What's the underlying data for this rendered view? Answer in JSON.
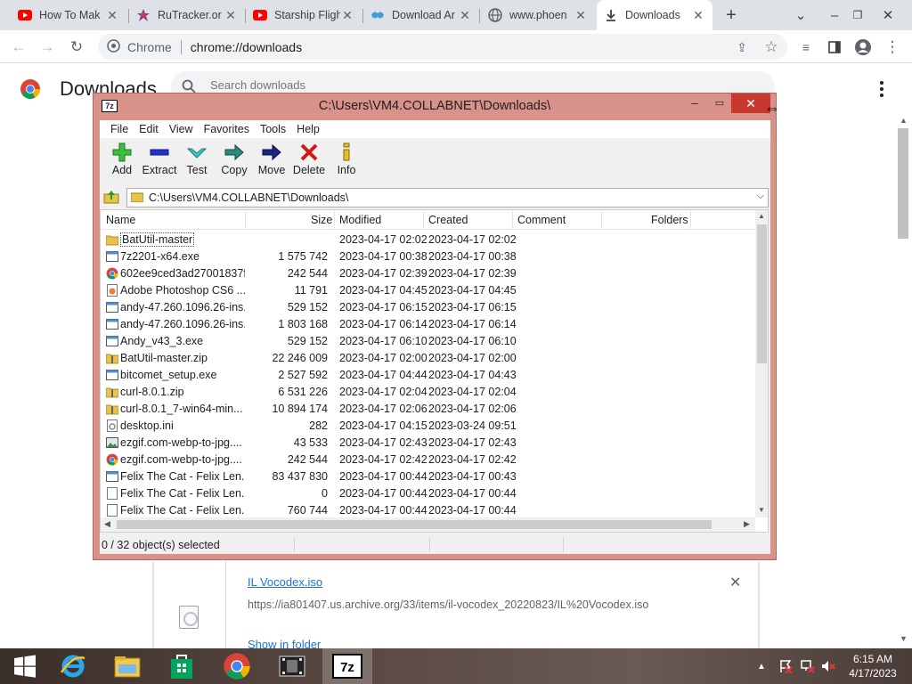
{
  "browser": {
    "tabs": [
      {
        "title": "How To Mak",
        "icon": "youtube-icon"
      },
      {
        "title": "RuTracker.or",
        "icon": "rutracker-icon"
      },
      {
        "title": "Starship Fligh",
        "icon": "youtube-icon"
      },
      {
        "title": "Download Ar",
        "icon": "archive-icon"
      },
      {
        "title": "www.phoen",
        "icon": "globe-icon"
      },
      {
        "title": "Downloads",
        "icon": "download-icon"
      }
    ],
    "omnibox": {
      "site": "Chrome",
      "url": "chrome://downloads"
    }
  },
  "downloads_page": {
    "title": "Downloads",
    "search_placeholder": "Search downloads",
    "item": {
      "filename": "IL Vocodex.iso",
      "url": "https://ia801407.us.archive.org/33/items/il-vocodex_20220823/IL%20Vocodex.iso",
      "show_in_folder": "Show in folder"
    }
  },
  "sevenzip": {
    "title": "C:\\Users\\VM4.COLLABNET\\Downloads\\",
    "app_icon_text": "7z",
    "menu": [
      "File",
      "Edit",
      "View",
      "Favorites",
      "Tools",
      "Help"
    ],
    "toolbar": [
      "Add",
      "Extract",
      "Test",
      "Copy",
      "Move",
      "Delete",
      "Info"
    ],
    "path": "C:\\Users\\VM4.COLLABNET\\Downloads\\",
    "columns": {
      "name": "Name",
      "size": "Size",
      "modified": "Modified",
      "created": "Created",
      "comment": "Comment",
      "folders": "Folders"
    },
    "files": [
      {
        "name": "BatUtil-master",
        "size": "",
        "modified": "2023-04-17 02:02",
        "created": "2023-04-17 02:02",
        "type": "folder"
      },
      {
        "name": "7z2201-x64.exe",
        "size": "1 575 742",
        "modified": "2023-04-17 00:38",
        "created": "2023-04-17 00:38",
        "type": "exe"
      },
      {
        "name": "602ee9ced3ad27001837f...",
        "size": "242 544",
        "modified": "2023-04-17 02:39",
        "created": "2023-04-17 02:39",
        "type": "chrome"
      },
      {
        "name": "Adobe Photoshop CS6 ...",
        "size": "11 791",
        "modified": "2023-04-17 04:45",
        "created": "2023-04-17 04:45",
        "type": "html"
      },
      {
        "name": "andy-47.260.1096.26-ins...",
        "size": "529 152",
        "modified": "2023-04-17 06:15",
        "created": "2023-04-17 06:15",
        "type": "exe"
      },
      {
        "name": "andy-47.260.1096.26-ins...",
        "size": "1 803 168",
        "modified": "2023-04-17 06:14",
        "created": "2023-04-17 06:14",
        "type": "exe"
      },
      {
        "name": "Andy_v43_3.exe",
        "size": "529 152",
        "modified": "2023-04-17 06:10",
        "created": "2023-04-17 06:10",
        "type": "exe"
      },
      {
        "name": "BatUtil-master.zip",
        "size": "22 246 009",
        "modified": "2023-04-17 02:00",
        "created": "2023-04-17 02:00",
        "type": "zip"
      },
      {
        "name": "bitcomet_setup.exe",
        "size": "2 527 592",
        "modified": "2023-04-17 04:44",
        "created": "2023-04-17 04:43",
        "type": "exe"
      },
      {
        "name": "curl-8.0.1.zip",
        "size": "6 531 226",
        "modified": "2023-04-17 02:04",
        "created": "2023-04-17 02:04",
        "type": "zip"
      },
      {
        "name": "curl-8.0.1_7-win64-min...",
        "size": "10 894 174",
        "modified": "2023-04-17 02:06",
        "created": "2023-04-17 02:06",
        "type": "zip"
      },
      {
        "name": "desktop.ini",
        "size": "282",
        "modified": "2023-04-17 04:15",
        "created": "2023-03-24 09:51",
        "type": "ini"
      },
      {
        "name": "ezgif.com-webp-to-jpg....",
        "size": "43 533",
        "modified": "2023-04-17 02:43",
        "created": "2023-04-17 02:43",
        "type": "image"
      },
      {
        "name": "ezgif.com-webp-to-jpg....",
        "size": "242 544",
        "modified": "2023-04-17 02:42",
        "created": "2023-04-17 02:42",
        "type": "chrome"
      },
      {
        "name": "Felix The Cat - Felix Len...",
        "size": "83 437 830",
        "modified": "2023-04-17 00:44",
        "created": "2023-04-17 00:43",
        "type": "exe"
      },
      {
        "name": "Felix The Cat - Felix Len...",
        "size": "0",
        "modified": "2023-04-17 00:44",
        "created": "2023-04-17 00:44",
        "type": "blank"
      },
      {
        "name": "Felix The Cat - Felix Len...",
        "size": "760 744",
        "modified": "2023-04-17 00:44",
        "created": "2023-04-17 00:44",
        "type": "blank"
      }
    ],
    "status": "0 / 32 object(s) selected"
  },
  "taskbar": {
    "apps": [
      "start-button",
      "internet-explorer-icon",
      "file-explorer-icon",
      "store-icon",
      "chrome-icon",
      "media-icon",
      "7zip-icon"
    ],
    "time": "6:15 AM",
    "date": "4/17/2023"
  }
}
